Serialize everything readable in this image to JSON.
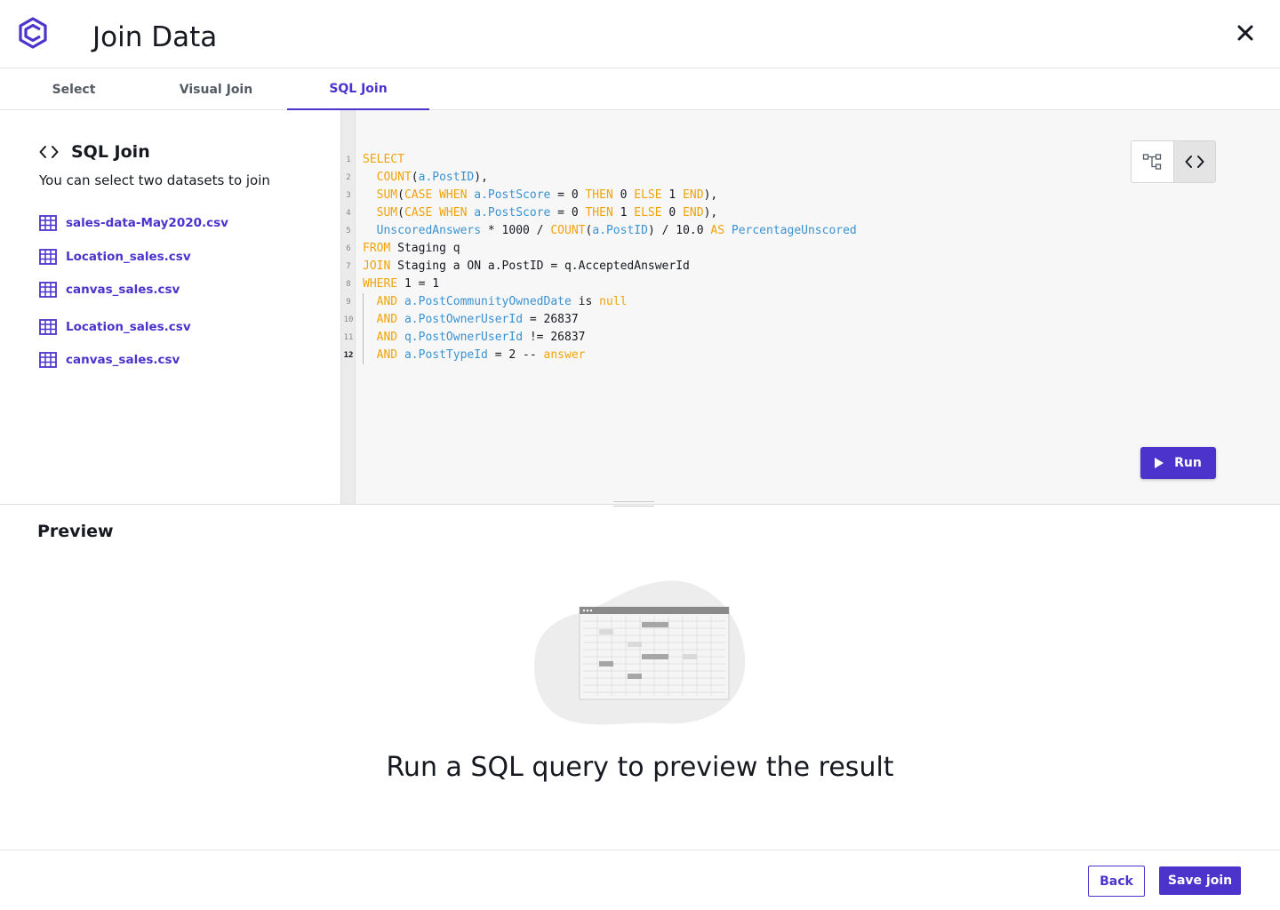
{
  "header": {
    "title": "Join Data"
  },
  "tabs": [
    {
      "label": "Select"
    },
    {
      "label": "Visual Join"
    },
    {
      "label": "SQL Join",
      "active": true
    }
  ],
  "left_panel": {
    "title": "SQL Join",
    "subtitle": "You can select two datasets to join",
    "datasets": [
      {
        "label": "sales-data-May2020.csv"
      },
      {
        "label": "Location_sales.csv"
      },
      {
        "label": "canvas_sales.csv"
      },
      {
        "label": "Location_sales.csv"
      },
      {
        "label": "canvas_sales.csv"
      }
    ]
  },
  "editor": {
    "current_line": 12,
    "lines": [
      {
        "n": "1",
        "indent": false,
        "tokens": [
          [
            "kw",
            "SELECT"
          ]
        ]
      },
      {
        "n": "2",
        "indent": true,
        "tokens": [
          [
            "kw",
            "COUNT"
          ],
          [
            "p",
            "("
          ],
          [
            "id",
            "a.PostID"
          ],
          [
            "p",
            "),"
          ]
        ]
      },
      {
        "n": "3",
        "indent": true,
        "tokens": [
          [
            "kw",
            "SUM"
          ],
          [
            "p",
            "("
          ],
          [
            "kw",
            "CASE WHEN"
          ],
          [
            "p",
            " "
          ],
          [
            "id",
            "a.PostScore"
          ],
          [
            "p",
            " = 0 "
          ],
          [
            "kw",
            "THEN"
          ],
          [
            "p",
            " 0 "
          ],
          [
            "kw",
            "ELSE"
          ],
          [
            "p",
            " 1 "
          ],
          [
            "kw",
            "END"
          ],
          [
            "p",
            "),"
          ]
        ]
      },
      {
        "n": "4",
        "indent": true,
        "tokens": [
          [
            "kw",
            "SUM"
          ],
          [
            "p",
            "("
          ],
          [
            "kw",
            "CASE WHEN"
          ],
          [
            "p",
            " "
          ],
          [
            "id",
            "a.PostScore"
          ],
          [
            "p",
            " = 0 "
          ],
          [
            "kw",
            "THEN"
          ],
          [
            "p",
            " 1 "
          ],
          [
            "kw",
            "ELSE"
          ],
          [
            "p",
            " 0 "
          ],
          [
            "kw",
            "END"
          ],
          [
            "p",
            "),"
          ]
        ]
      },
      {
        "n": "5",
        "indent": true,
        "tokens": [
          [
            "id",
            "UnscoredAnswers"
          ],
          [
            "p",
            " * 1000 / "
          ],
          [
            "kw",
            "COUNT"
          ],
          [
            "p",
            "("
          ],
          [
            "id",
            "a.PostID"
          ],
          [
            "p",
            ") / 10.0 "
          ],
          [
            "kw",
            "AS"
          ],
          [
            "p",
            " "
          ],
          [
            "id",
            "PercentageUnscored"
          ]
        ]
      },
      {
        "n": "6",
        "indent": false,
        "tokens": [
          [
            "kw",
            "FROM"
          ],
          [
            "p",
            " Staging q"
          ]
        ]
      },
      {
        "n": "7",
        "indent": false,
        "tokens": [
          [
            "kw",
            "JOIN"
          ],
          [
            "p",
            " Staging a ON a.PostID = q.AcceptedAnswerId"
          ]
        ]
      },
      {
        "n": "8",
        "indent": false,
        "tokens": [
          [
            "kw",
            "WHERE"
          ],
          [
            "p",
            " 1 = 1"
          ]
        ]
      },
      {
        "n": "9",
        "indent": true,
        "guide": true,
        "tokens": [
          [
            "kw",
            "AND"
          ],
          [
            "p",
            " "
          ],
          [
            "id",
            "a.PostCommunityOwnedDate"
          ],
          [
            "p",
            " is "
          ],
          [
            "kw",
            "null"
          ]
        ]
      },
      {
        "n": "10",
        "indent": true,
        "guide": true,
        "tokens": [
          [
            "kw",
            "AND"
          ],
          [
            "p",
            " "
          ],
          [
            "id",
            "a.PostOwnerUserId"
          ],
          [
            "p",
            " = 26837"
          ]
        ]
      },
      {
        "n": "11",
        "indent": true,
        "guide": true,
        "tokens": [
          [
            "kw",
            "AND"
          ],
          [
            "p",
            " "
          ],
          [
            "id",
            "q.PostOwnerUserId"
          ],
          [
            "p",
            " != 26837"
          ]
        ]
      },
      {
        "n": "12",
        "indent": true,
        "guide": true,
        "tokens": [
          [
            "kw",
            "AND"
          ],
          [
            "p",
            " "
          ],
          [
            "id",
            "a.PostTypeId"
          ],
          [
            "p",
            " = 2 -- "
          ],
          [
            "kw",
            "answer"
          ]
        ]
      }
    ],
    "run_label": "Run",
    "mode_icons": [
      "visual-diagram-icon",
      "code-brackets-icon"
    ]
  },
  "preview": {
    "title": "Preview",
    "empty_message": "Run a SQL query to preview the result"
  },
  "footer": {
    "back_label": "Back",
    "save_label": "Save join"
  },
  "colors": {
    "accent": "#4c33cc",
    "keyword": "#f0a30a",
    "identifier": "#3b92d1"
  }
}
